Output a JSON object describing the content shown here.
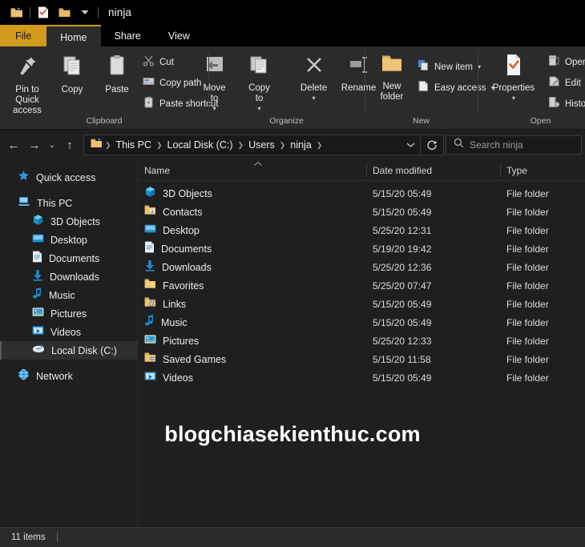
{
  "window": {
    "title": "ninja",
    "quick_access_icons": [
      "new-folder-icon",
      "properties-check-icon",
      "folder-icon",
      "customize-chevron-icon"
    ]
  },
  "colors": {
    "file_tab_accent": "#d19a1d",
    "window_bg": "#1f1f1f",
    "ribbon_bg": "#2b2b2b",
    "titlebar_bg": "#000000",
    "folder_yellow": "#f0c274",
    "accent_blue": "#3a96dd"
  },
  "tabs": [
    {
      "label": "File",
      "state": "file"
    },
    {
      "label": "Home",
      "state": "active"
    },
    {
      "label": "Share",
      "state": "normal"
    },
    {
      "label": "View",
      "state": "normal"
    }
  ],
  "ribbon": {
    "groups": [
      {
        "label": "Clipboard",
        "big_buttons": [
          {
            "label": "Pin to Quick\naccess",
            "icon": "pin-icon"
          },
          {
            "label": "Copy",
            "icon": "copy-icon"
          },
          {
            "label": "Paste",
            "icon": "paste-icon"
          }
        ],
        "small_buttons": [
          {
            "label": "Cut",
            "icon": "scissors-icon"
          },
          {
            "label": "Copy path",
            "icon": "copy-path-icon"
          },
          {
            "label": "Paste shortcut",
            "icon": "paste-shortcut-icon"
          }
        ]
      },
      {
        "label": "Organize",
        "big_buttons": [
          {
            "label": "Move\nto",
            "icon": "move-to-icon",
            "caret": true
          },
          {
            "label": "Copy\nto",
            "icon": "copy-to-icon",
            "caret": true
          },
          {
            "label": "Delete",
            "icon": "delete-x-icon",
            "caret": true
          },
          {
            "label": "Rename",
            "icon": "rename-icon"
          }
        ],
        "small_buttons": []
      },
      {
        "label": "New",
        "big_buttons": [
          {
            "label": "New\nfolder",
            "icon": "new-folder-icon"
          }
        ],
        "small_buttons": [
          {
            "label": "New item",
            "icon": "new-item-icon",
            "caret": true
          },
          {
            "label": "Easy access",
            "icon": "easy-access-icon",
            "caret": true
          }
        ]
      },
      {
        "label": "Open",
        "big_buttons": [
          {
            "label": "Properties",
            "icon": "properties-icon",
            "caret": true
          }
        ],
        "small_buttons": [
          {
            "label": "Open",
            "icon": "open-icon",
            "caret": true
          },
          {
            "label": "Edit",
            "icon": "edit-icon"
          },
          {
            "label": "History",
            "icon": "history-icon"
          }
        ]
      }
    ]
  },
  "navbar": {
    "back": "←",
    "forward": "→",
    "recent": "⌄",
    "up": "↑",
    "breadcrumbs": [
      "This PC",
      "Local Disk (C:)",
      "Users",
      "ninja"
    ],
    "dropdown": "⌄",
    "refresh": "⟳",
    "search_placeholder": "Search ninja",
    "search_value": ""
  },
  "sidebar": {
    "items": [
      {
        "label": "Quick access",
        "icon": "star-icon",
        "level": 0,
        "selected": false,
        "gap_after": true
      },
      {
        "label": "This PC",
        "icon": "this-pc-icon",
        "level": 0,
        "selected": false
      },
      {
        "label": "3D Objects",
        "icon": "3d-objects-icon",
        "level": 1,
        "selected": false
      },
      {
        "label": "Desktop",
        "icon": "desktop-icon",
        "level": 1,
        "selected": false
      },
      {
        "label": "Documents",
        "icon": "documents-icon",
        "level": 1,
        "selected": false
      },
      {
        "label": "Downloads",
        "icon": "downloads-icon",
        "level": 1,
        "selected": false
      },
      {
        "label": "Music",
        "icon": "music-icon",
        "level": 1,
        "selected": false
      },
      {
        "label": "Pictures",
        "icon": "pictures-icon",
        "level": 1,
        "selected": false
      },
      {
        "label": "Videos",
        "icon": "videos-icon",
        "level": 1,
        "selected": false
      },
      {
        "label": "Local Disk (C:)",
        "icon": "local-disk-icon",
        "level": 1,
        "selected": true,
        "gap_after": true
      },
      {
        "label": "Network",
        "icon": "network-icon",
        "level": 0,
        "selected": false
      }
    ]
  },
  "filelist": {
    "columns": [
      "Name",
      "Date modified",
      "Type"
    ],
    "sort_column": "Name",
    "sort_direction": "asc",
    "rows": [
      {
        "name": "3D Objects",
        "date": "5/15/20 05:49",
        "type": "File folder",
        "icon": "3d-objects-icon"
      },
      {
        "name": "Contacts",
        "date": "5/15/20 05:49",
        "type": "File folder",
        "icon": "contacts-folder-icon"
      },
      {
        "name": "Desktop",
        "date": "5/25/20 12:31",
        "type": "File folder",
        "icon": "desktop-folder-icon"
      },
      {
        "name": "Documents",
        "date": "5/19/20 19:42",
        "type": "File folder",
        "icon": "documents-folder-icon"
      },
      {
        "name": "Downloads",
        "date": "5/25/20 12:36",
        "type": "File folder",
        "icon": "downloads-folder-icon"
      },
      {
        "name": "Favorites",
        "date": "5/25/20 07:47",
        "type": "File folder",
        "icon": "favorites-folder-icon"
      },
      {
        "name": "Links",
        "date": "5/15/20 05:49",
        "type": "File folder",
        "icon": "links-folder-icon"
      },
      {
        "name": "Music",
        "date": "5/15/20 05:49",
        "type": "File folder",
        "icon": "music-folder-icon"
      },
      {
        "name": "Pictures",
        "date": "5/25/20 12:33",
        "type": "File folder",
        "icon": "pictures-folder-icon"
      },
      {
        "name": "Saved Games",
        "date": "5/15/20 11:58",
        "type": "File folder",
        "icon": "saved-games-folder-icon"
      },
      {
        "name": "Videos",
        "date": "5/15/20 05:49",
        "type": "File folder",
        "icon": "videos-folder-icon"
      }
    ]
  },
  "watermark": {
    "text": "blogchiasekienthuc.com"
  },
  "statusbar": {
    "item_count": "11 items"
  }
}
